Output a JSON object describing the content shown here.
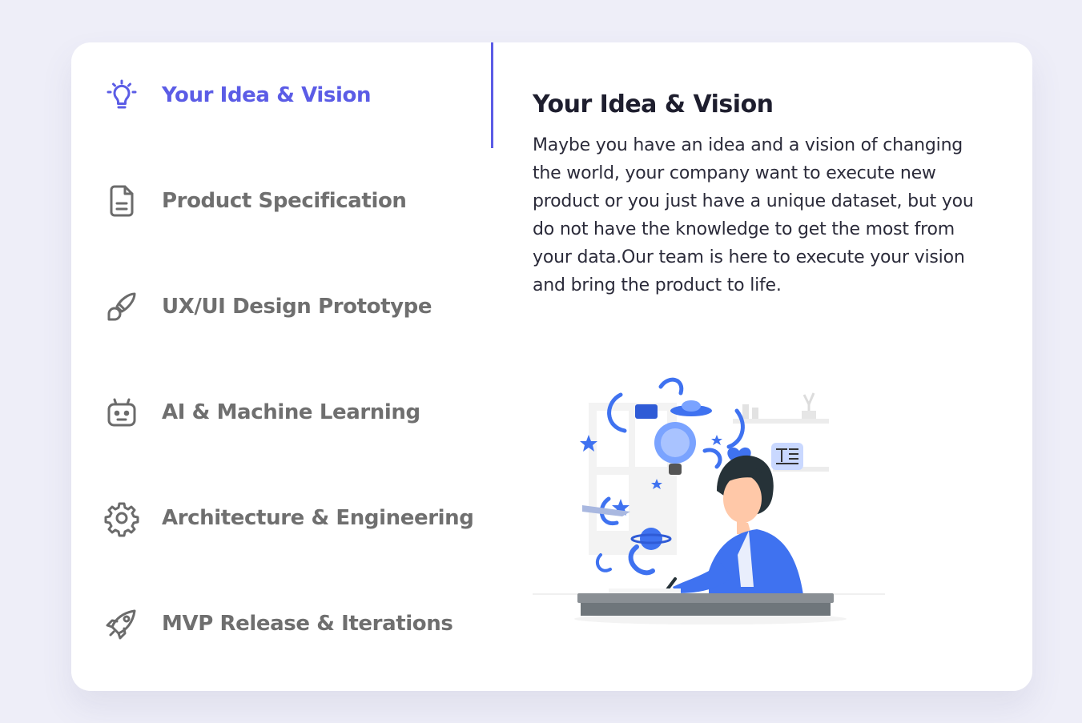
{
  "steps": [
    {
      "label": "Your Idea & Vision",
      "icon": "lightbulb-icon",
      "active": true
    },
    {
      "label": "Product Specification",
      "icon": "document-icon",
      "active": false
    },
    {
      "label": "UX/UI Design Prototype",
      "icon": "brush-icon",
      "active": false
    },
    {
      "label": "AI & Machine Learning",
      "icon": "robot-icon",
      "active": false
    },
    {
      "label": "Architecture & Engineering",
      "icon": "gear-icon",
      "active": false
    },
    {
      "label": "MVP Release & Iterations",
      "icon": "rocket-icon",
      "active": false
    }
  ],
  "detail": {
    "title": "Your Idea & Vision",
    "body": "Maybe you have an idea and a vision of changing the world, your company want to execute new product or you just have a unique dataset, but you do not have the knowledge to get the most from your data.Our team is here to execute your vision and bring the product to life."
  },
  "colors": {
    "accent": "#5b5ce6",
    "inactive_text": "#6f6f6f",
    "background": "#eeeef8",
    "card": "#ffffff",
    "illustration_blue": "#3f72f0"
  }
}
